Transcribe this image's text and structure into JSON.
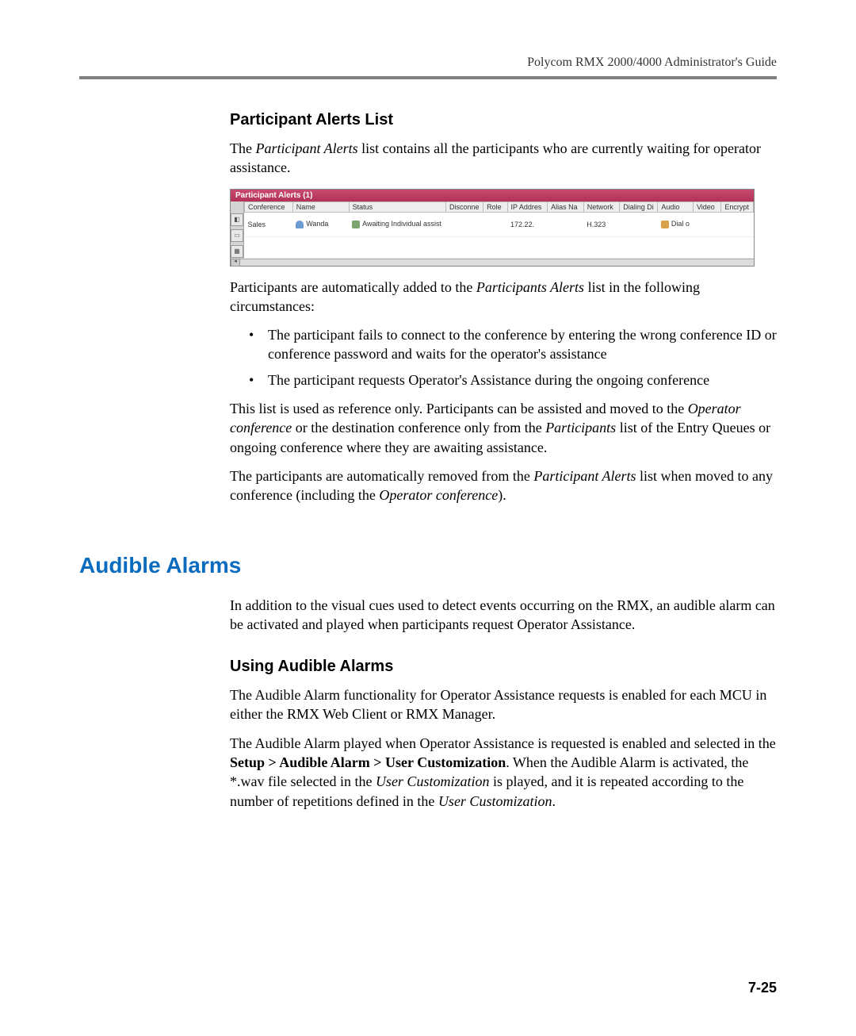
{
  "header": {
    "doc_title": "Polycom RMX 2000/4000 Administrator's Guide"
  },
  "section1": {
    "heading": "Participant Alerts List",
    "intro_pre": "The ",
    "intro_em": "Participant Alerts",
    "intro_post": " list contains all the participants who are currently waiting for operator assistance.",
    "after_shot_pre": "Participants are automatically added to the ",
    "after_shot_em": "Participants Alerts",
    "after_shot_post": " list in the following circumstances:",
    "bullets": [
      "The participant fails to connect to the conference by entering the wrong conference ID or conference password and waits for the operator's assistance",
      "The participant requests Operator's Assistance during the ongoing conference"
    ],
    "ref_p1_a": "This list is used as reference only. Participants can be assisted and moved to the ",
    "ref_p1_em1": "Operator conference",
    "ref_p1_b": " or the destination conference only from the ",
    "ref_p1_em2": "Participants",
    "ref_p1_c": " list of the Entry Queues or ongoing conference where they are awaiting assistance.",
    "ref_p2_a": "The participants are automatically removed from the ",
    "ref_p2_em1": "Participant Alerts",
    "ref_p2_b": " list when moved to any conference (including the ",
    "ref_p2_em2": "Operator conference",
    "ref_p2_c": ")."
  },
  "alerts_panel": {
    "title": "Participant Alerts (1)",
    "columns": [
      "Conference",
      "Name",
      "Status",
      "Disconne",
      "Role",
      "IP Addres",
      "Alias Na",
      "Network",
      "Dialing Di",
      "Audio",
      "Video",
      "Encrypt"
    ],
    "row": {
      "conference": "Sales",
      "name": "Wanda",
      "status": "Awaiting Individual assist",
      "disconne": "",
      "role": "",
      "ip": "172.22.",
      "alias": "",
      "network": "H.323",
      "dialing": "",
      "audio": "Dial o",
      "video": "",
      "encrypt": ""
    }
  },
  "section2": {
    "heading": "Audible Alarms",
    "intro": "In addition to the visual cues used to detect events occurring on the RMX, an audible alarm can be activated and played when participants request Operator Assistance.",
    "sub_heading": "Using Audible Alarms",
    "p1": "The Audible Alarm functionality for Operator Assistance requests is enabled for each MCU in either the RMX Web Client or RMX Manager.",
    "p2_a": "The Audible Alarm played when Operator Assistance is requested is enabled and selected in the ",
    "p2_bold": "Setup > Audible Alarm > User Customization",
    "p2_b": ". When the Audible Alarm is activated, the *.wav file selected in the ",
    "p2_em1": "User Customization",
    "p2_c": " is played, and it is repeated according to the number of repetitions defined  in the ",
    "p2_em2": "User Customization",
    "p2_d": "."
  },
  "footer": {
    "page_number": "7-25"
  }
}
